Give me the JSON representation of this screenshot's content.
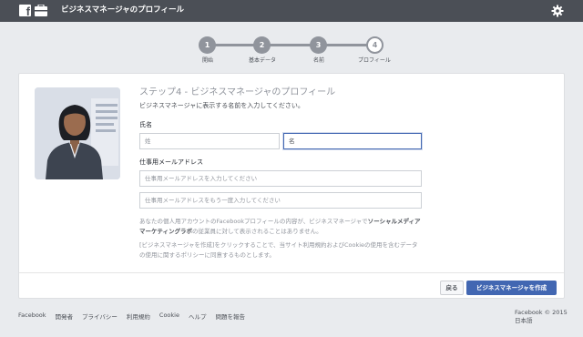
{
  "topbar": {
    "title": "ビジネスマネージャのプロフィール",
    "logo_letter": "f"
  },
  "stepper": {
    "steps": [
      {
        "number": "1",
        "label": "開始"
      },
      {
        "number": "2",
        "label": "基本データ"
      },
      {
        "number": "3",
        "label": "名前"
      },
      {
        "number": "4",
        "label": "プロフィール"
      }
    ],
    "current_step": 4
  },
  "card": {
    "title": "ステップ4 - ビジネスマネージャのプロフィール",
    "subtitle": "ビジネスマネージャに表示する名前を入力してください。",
    "name_label": "氏名",
    "last_name_placeholder": "姓",
    "first_name_value": "名",
    "email_label": "仕事用メールアドレス",
    "email_placeholder": "仕事用メールアドレスを入力してください",
    "email_confirm_placeholder": "仕事用メールアドレスをもう一度入力してください",
    "note1_pre": "あなたの個人用アカウントのFacebookプロフィールの内容が、ビジネスマネージャで",
    "note1_bold": "ソーシャルメディアマーケティングラボ",
    "note1_post": "の従業員に対して表示されることはありません。",
    "note2": "[ビジネスマネージャを作成]をクリックすることで、当サイト利用規約およびCookieの使用を含むデータの使用に関するポリシーに同意するものとします。",
    "back_button": "戻る",
    "create_button": "ビジネスマネージャを作成"
  },
  "footer": {
    "links": [
      "Facebook",
      "開発者",
      "プライバシー",
      "利用規約",
      "Cookie",
      "ヘルプ",
      "問題を報告"
    ],
    "copyright": "Facebook © 2015",
    "language": "日本語"
  },
  "colors": {
    "topbar": "#4b4f56",
    "accent": "#4267b2",
    "step_gray": "#90949c"
  }
}
